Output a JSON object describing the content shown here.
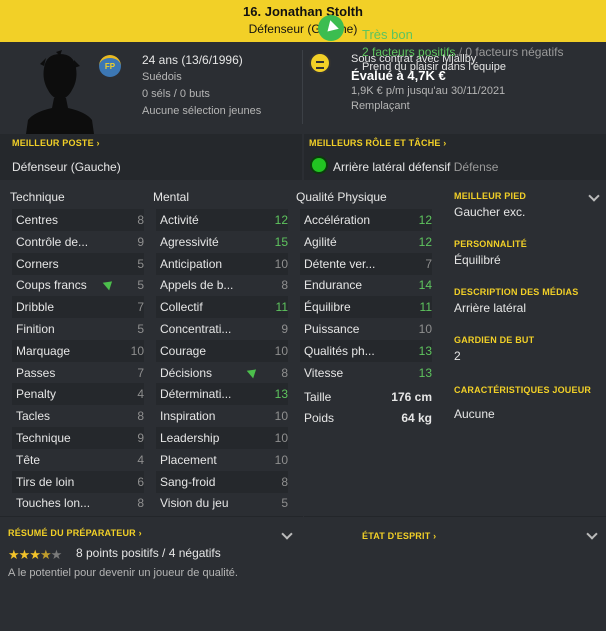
{
  "header": {
    "name": "16. Jonathan Stolth",
    "position": "Défenseur (Gauche)"
  },
  "profile": {
    "badge": "FP",
    "age": "24 ans (13/6/1996)",
    "nationality": "Suédois",
    "caps": "0 séls / 0 buts",
    "youth": "Aucune sélection jeunes",
    "contract": "Sous contrat avec Mjällby",
    "value": "Évalué à 4,7K €",
    "wage": "1,9K € p/m jusqu'au 30/11/2021",
    "status": "Remplaçant"
  },
  "best_position": {
    "title": "MEILLEUR POSTE",
    "value": "Défenseur (Gauche)"
  },
  "best_role": {
    "title": "MEILLEURS RÔLE ET TÂCHE",
    "role": "Arrière latéral défensif",
    "duty": "Défense"
  },
  "technique": {
    "title": "Technique",
    "attrs": [
      {
        "name": "Centres",
        "value": "8"
      },
      {
        "name": "Contrôle de...",
        "value": "9"
      },
      {
        "name": "Corners",
        "value": "5"
      },
      {
        "name": "Coups francs",
        "value": "5"
      },
      {
        "name": "Dribble",
        "value": "7"
      },
      {
        "name": "Finition",
        "value": "5"
      },
      {
        "name": "Marquage",
        "value": "10"
      },
      {
        "name": "Passes",
        "value": "7"
      },
      {
        "name": "Penalty",
        "value": "4"
      },
      {
        "name": "Tacles",
        "value": "8"
      },
      {
        "name": "Technique",
        "value": "9"
      },
      {
        "name": "Tête",
        "value": "4"
      },
      {
        "name": "Tirs de loin",
        "value": "6"
      },
      {
        "name": "Touches lon...",
        "value": "8"
      }
    ]
  },
  "mental": {
    "title": "Mental",
    "attrs": [
      {
        "name": "Activité",
        "value": "12"
      },
      {
        "name": "Agressivité",
        "value": "15"
      },
      {
        "name": "Anticipation",
        "value": "10"
      },
      {
        "name": "Appels de b...",
        "value": "8"
      },
      {
        "name": "Collectif",
        "value": "11"
      },
      {
        "name": "Concentrati...",
        "value": "9"
      },
      {
        "name": "Courage",
        "value": "10"
      },
      {
        "name": "Décisions",
        "value": "8"
      },
      {
        "name": "Déterminati...",
        "value": "13"
      },
      {
        "name": "Inspiration",
        "value": "10"
      },
      {
        "name": "Leadership",
        "value": "10"
      },
      {
        "name": "Placement",
        "value": "10"
      },
      {
        "name": "Sang-froid",
        "value": "8"
      },
      {
        "name": "Vision du jeu",
        "value": "5"
      }
    ]
  },
  "physical": {
    "title": "Qualité Physique",
    "attrs": [
      {
        "name": "Accélération",
        "value": "12"
      },
      {
        "name": "Agilité",
        "value": "12"
      },
      {
        "name": "Détente ver...",
        "value": "7"
      },
      {
        "name": "Endurance",
        "value": "14"
      },
      {
        "name": "Équilibre",
        "value": "11"
      },
      {
        "name": "Puissance",
        "value": "10"
      },
      {
        "name": "Qualités ph...",
        "value": "13"
      },
      {
        "name": "Vitesse",
        "value": "13"
      }
    ],
    "height_label": "Taille",
    "height": "176 cm",
    "weight_label": "Poids",
    "weight": "64 kg"
  },
  "side": {
    "foot_title": "MEILLEUR PIED",
    "foot": "Gaucher exc.",
    "personality_title": "PERSONNALITÉ",
    "personality": "Équilibré",
    "media_title": "DESCRIPTION DES MÉDIAS",
    "media": "Arrière latéral",
    "gk_title": "GARDIEN DE BUT",
    "gk": "2",
    "traits_title": "CARACTÉRISTIQUES JOUEUR",
    "traits": "Aucune"
  },
  "report": {
    "title": "RÉSUMÉ DU PRÉPARATEUR",
    "stars": 3.5,
    "stars_max": 5,
    "points": "8 points positifs / 4 négatifs",
    "note": "A le potentiel pour devenir un joueur de qualité."
  },
  "mood": {
    "title": "ÉTAT D'ESPRIT",
    "status": "Très bon",
    "positive": "2 facteurs positifs",
    "separator": "/",
    "negative": "0 facteurs négatifs",
    "note": "Prend du plaisir dans l'équipe"
  },
  "colors": {
    "accent": "#f2d027",
    "high_value": "#5ec45e",
    "mid_value": "#8f8f8f"
  }
}
